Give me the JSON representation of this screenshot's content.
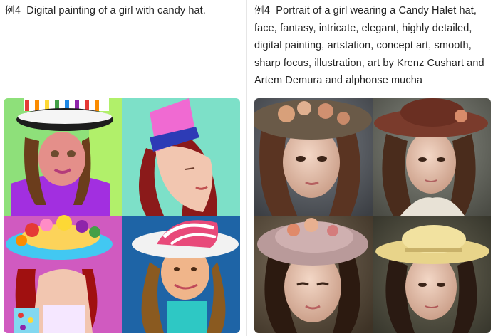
{
  "examples": [
    {
      "tag": "例4",
      "prompt": "Digital painting of a girl with candy hat.",
      "images": [
        {
          "name": "image-tl"
        },
        {
          "name": "image-tr"
        },
        {
          "name": "image-bl"
        },
        {
          "name": "image-br"
        }
      ]
    },
    {
      "tag": "例4",
      "prompt": "Portrait of a girl wearing a Candy Halet hat, face, fantasy, intricate, elegant, highly detailed, digital painting, artstation, concept art, smooth, sharp focus, illustration, art by Krenz Cushart and Artem Demura and alphonse mucha",
      "images": [
        {
          "name": "image-tl"
        },
        {
          "name": "image-tr"
        },
        {
          "name": "image-bl"
        },
        {
          "name": "image-br"
        }
      ]
    }
  ]
}
